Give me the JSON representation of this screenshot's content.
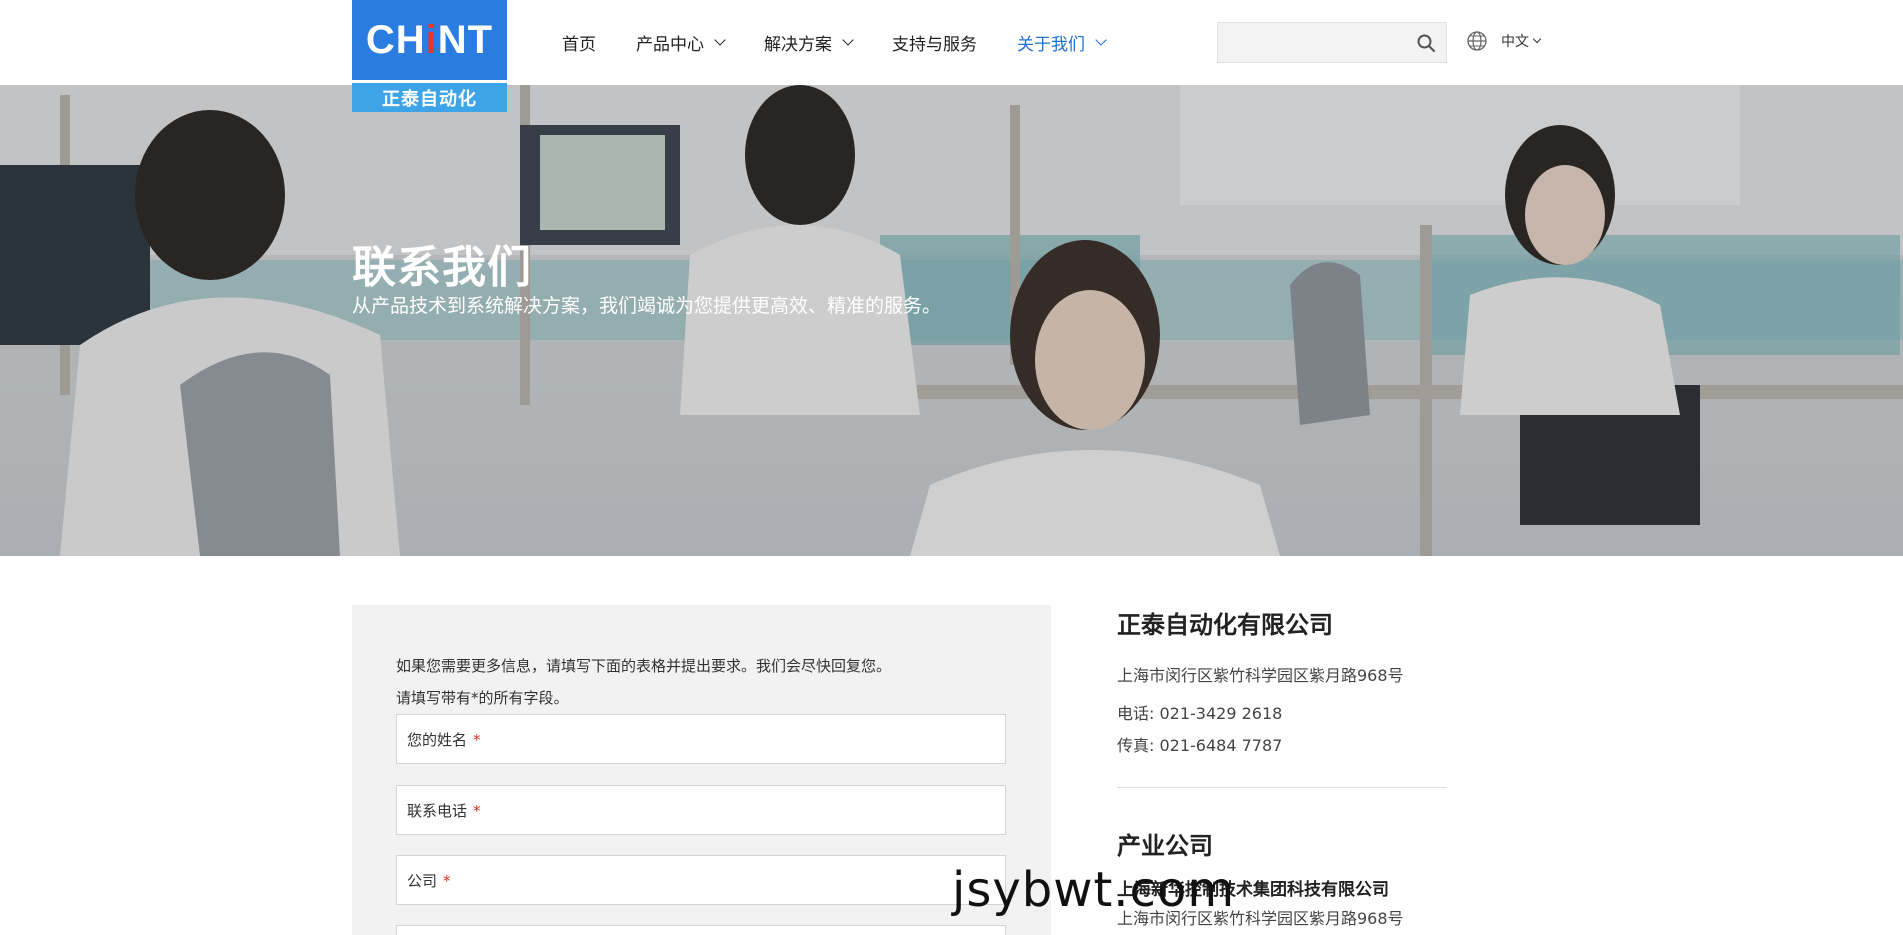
{
  "logo": {
    "word_pre": "CH",
    "word_dot": "i",
    "word_post": "NT",
    "tagline": "正泰自动化"
  },
  "nav": {
    "home": "首页",
    "products": "产品中心",
    "solutions": "解决方案",
    "support": "支持与服务",
    "about": "关于我们"
  },
  "search": {
    "placeholder": ""
  },
  "language": {
    "label": "中文"
  },
  "hero": {
    "title": "联系我们",
    "subtitle": "从产品技术到系统解决方案，我们竭诚为您提供更高效、精准的服务。"
  },
  "form": {
    "intro": "如果您需要更多信息，请填写下面的表格并提出要求。我们会尽快回复您。",
    "note": "请填写带有*的所有字段。",
    "fields": [
      {
        "label": "您的姓名",
        "required": "*"
      },
      {
        "label": "联系电话",
        "required": "*"
      },
      {
        "label": "公司",
        "required": "*"
      }
    ]
  },
  "contact": {
    "company": "正泰自动化有限公司",
    "address": "上海市闵行区紫竹科学园区紫月路968号",
    "phone": "电话: 021-3429 2618",
    "fax": "传真: 021-6484 7787",
    "section_title": "产业公司",
    "sub_company": "上海新华控制技术集团科技有限公司",
    "sub_address": "上海市闵行区紫竹科学园区紫月路968号"
  },
  "watermark": "jsybwt.com",
  "colors": {
    "brand_blue": "#2b7ce0",
    "brand_light": "#3ea4e8",
    "nav_active": "#1f6fd1",
    "required": "#d93025"
  }
}
